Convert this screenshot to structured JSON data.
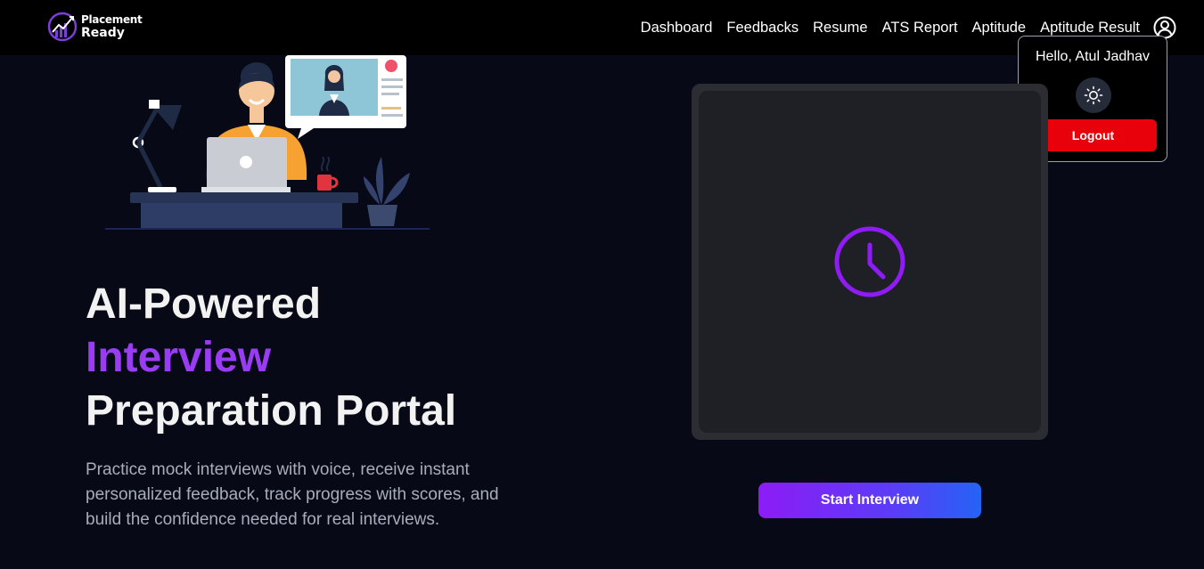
{
  "brand": {
    "line1": "Placement",
    "line2": "Ready"
  },
  "nav": {
    "items": [
      {
        "label": "Dashboard"
      },
      {
        "label": "Feedbacks"
      },
      {
        "label": "Resume"
      },
      {
        "label": "ATS Report"
      },
      {
        "label": "Aptitude"
      },
      {
        "label": "Aptitude Result"
      }
    ],
    "user_icon": "user-circle-icon"
  },
  "user_menu": {
    "greeting": "Hello, Atul Jadhav",
    "theme_icon": "sun-icon",
    "logout_label": "Logout",
    "logout_color": "#e8000b"
  },
  "hero": {
    "title_line1": "AI-Powered",
    "title_accent": "Interview",
    "title_line3": "Preparation Portal",
    "description": "Practice mock interviews with voice, receive instant personalized feedback, track progress with scores, and build the confidence needed for real interviews.",
    "accent_color": "#9b3cf5"
  },
  "interview_panel": {
    "placeholder_icon": "clock-icon",
    "start_label": "Start Interview"
  }
}
